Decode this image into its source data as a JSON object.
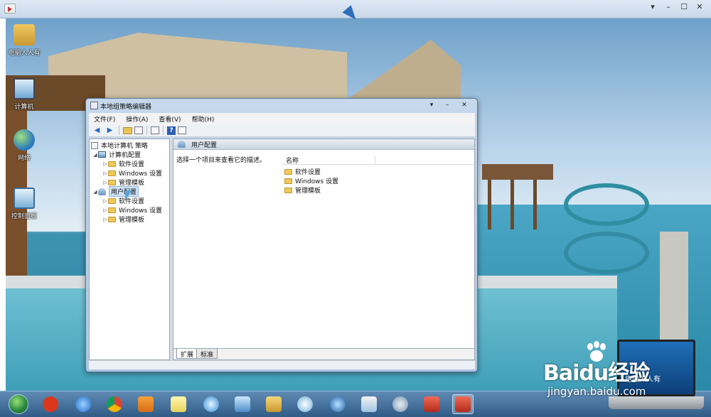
{
  "desktop": {
    "icons": [
      {
        "label": "电脑人人有"
      },
      {
        "label": "计算机"
      },
      {
        "label": "网络"
      },
      {
        "label": "控制面板"
      }
    ]
  },
  "window": {
    "title": "本地组策略编辑器",
    "menu": [
      "文件(F)",
      "操作(A)",
      "查看(V)",
      "帮助(H)"
    ]
  },
  "tree": {
    "root": "本地计算机 策略",
    "computer_config": "计算机配置",
    "user_config": "用户配置",
    "computer_children": [
      "软件设置",
      "Windows 设置",
      "管理模板"
    ],
    "user_children": [
      "软件设置",
      "Windows 设置",
      "管理模板"
    ]
  },
  "detail": {
    "header": "用户配置",
    "description": "选择一个项目来查看它的描述。",
    "column_name": "名称",
    "items": [
      "软件设置",
      "Windows 设置",
      "管理模板"
    ]
  },
  "tabs": [
    "扩展",
    "标准"
  ],
  "watermark": {
    "logo": "Baidu经验",
    "url": "jingyan.baidu.com",
    "laptop_text": "电脑人人有"
  },
  "colors": {
    "accent": "#2d67b8",
    "taskbar": "#2f5b86",
    "folder": "#efc95a"
  }
}
